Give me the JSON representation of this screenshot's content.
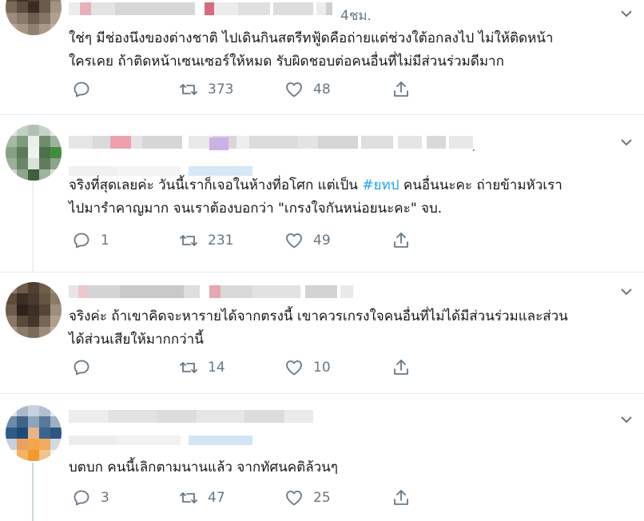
{
  "tweets": [
    {
      "timestamp": "4ชม.",
      "text_lines": [
        "ใช่ๆ มีช่องนึงของต่างชาติ ไปเดินกินสตรีทฟู้ดคือถ่ายแต่ช่วงใต้อกลงไป ไม่ให้ติดหน้า",
        "ใครเคย ถ้าติดหน้าเซนเซอร์ให้หมด รับผิดชอบต่อคนอื่นที่ไม่มีส่วนร่วมดีมาก"
      ],
      "replies": "",
      "retweets": "373",
      "likes": "48"
    },
    {
      "timestamp": ".",
      "text_pre": "จริงที่สุดเลยค่ะ วันนี้เราก็เจอในห้างที่อโศก แต่เป็น ",
      "hashtag": "#ยทป",
      "text_post": " คนอื่นนะคะ ถ่ายข้ามหัวเรา",
      "text_line2": "ไปมารำคาญมาก จนเราต้องบอกว่า \"เกรงใจกันหน่อยนะคะ\" จบ.",
      "replies": "1",
      "retweets": "231",
      "likes": "49"
    },
    {
      "timestamp": "",
      "text_lines": [
        "จริงค่ะ ถ้าเขาคิดจะหารายได้จากตรงนี้ เขาควรเกรงใจคนอื่นที่ไม่ได้มีส่วนร่วมและส่วน",
        "ได้ส่วนเสียให้มากกว่านี้"
      ],
      "replies": "",
      "retweets": "14",
      "likes": "10"
    },
    {
      "timestamp": "",
      "text_lines": [
        "บตบก คนนี้เลิกตามนานแล้ว จากทัศนคติล้วนๆ"
      ],
      "replies": "3",
      "retweets": "47",
      "likes": "25"
    }
  ],
  "icons": {
    "reply": "reply-icon",
    "retweet": "retweet-icon",
    "like": "heart-icon",
    "share": "share-icon",
    "more": "chevron-down-icon"
  },
  "colors": {
    "text": "#14171a",
    "secondary": "#657786",
    "hashtag": "#1da1f2",
    "divider": "#e6ecf0",
    "thread_line": "#ccd6dd"
  }
}
